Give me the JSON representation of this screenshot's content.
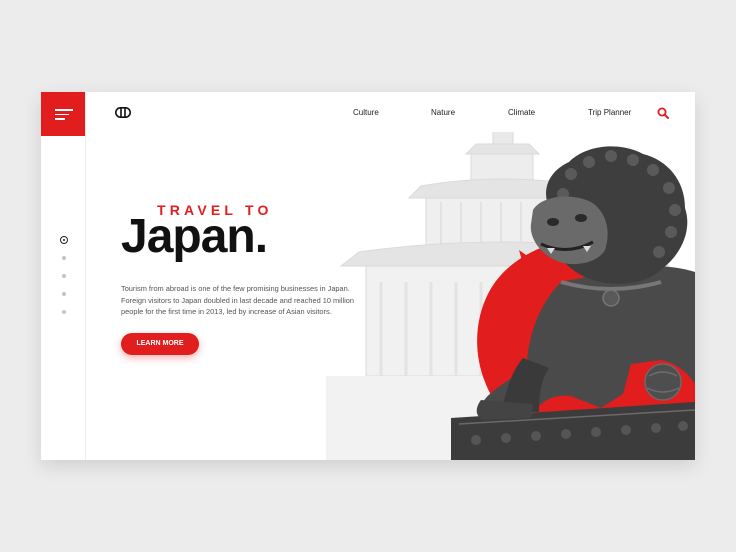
{
  "header": {
    "nav": [
      {
        "label": "Culture"
      },
      {
        "label": "Nature"
      },
      {
        "label": "Climate"
      },
      {
        "label": "Trip Planner"
      }
    ]
  },
  "hero": {
    "eyebrow": "TRAVEL TO",
    "title": "Japan.",
    "description": "Tourism from abroad is one of the few promising businesses in Japan. Foreign visitors to Japan doubled in last decade and reached 10 million people for the first time in 2013, led by increase of Asian visitors.",
    "cta_label": "LEARN MORE"
  },
  "pagination": {
    "count": 5,
    "active_index": 0
  },
  "icons": {
    "menu": "hamburger-icon",
    "logo": "brand-logo-icon",
    "search": "search-icon"
  },
  "colors": {
    "accent": "#e21d1d",
    "text": "#111111",
    "muted": "#555555"
  }
}
